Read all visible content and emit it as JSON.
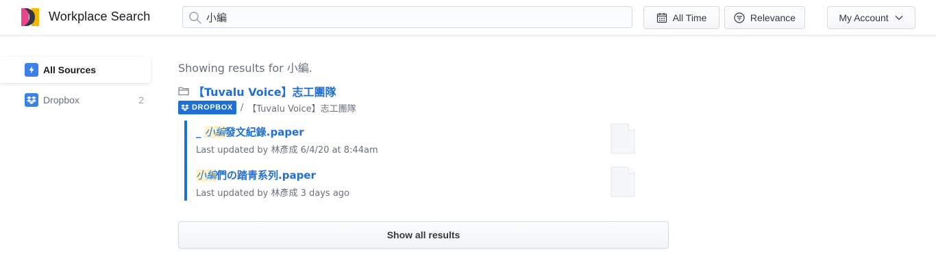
{
  "header": {
    "app_title": "Workplace Search",
    "search_value": "小編",
    "time_filter_label": "All Time",
    "sort_label": "Relevance",
    "account_label": "My Account"
  },
  "sidebar": {
    "items": [
      {
        "label": "All Sources",
        "icon": "lightning-icon",
        "active": true
      },
      {
        "label": "Dropbox",
        "icon": "dropbox-icon",
        "count": "2"
      }
    ]
  },
  "main": {
    "results_prefix": "Showing results for",
    "query": "小編",
    "results_suffix": ".",
    "group": {
      "folder_title": "【Tuvalu Voice】志工團隊",
      "source_badge": "DROPBOX",
      "breadcrumb_sep": "/",
      "breadcrumb": "【Tuvalu Voice】志工團隊"
    },
    "results": [
      {
        "prefix": "_ ",
        "highlight": "小編",
        "rest": "發文紀錄.paper",
        "meta": "Last updated by 林彥成 6/4/20 at 8:44am"
      },
      {
        "prefix": "",
        "highlight": "小編",
        "rest": "們の踏青系列.paper",
        "meta": "Last updated by 林彥成 3 days ago"
      }
    ],
    "show_all_label": "Show all results"
  },
  "colors": {
    "accent": "#1f6fd6",
    "highlight_bg": "#fef2c8",
    "logo_pink": "#e8488a",
    "logo_yellow": "#f5b700",
    "logo_dark": "#343741"
  }
}
